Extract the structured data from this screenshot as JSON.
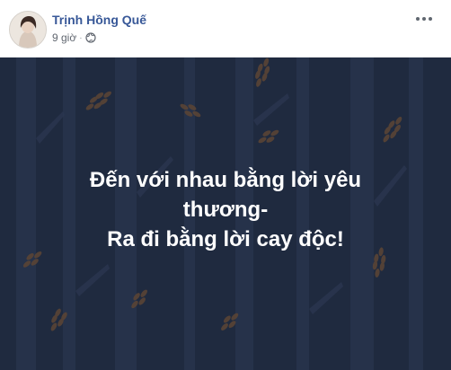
{
  "post": {
    "author_name": "Trịnh Hồng Quế",
    "timestamp": "9 giờ",
    "separator": "·",
    "privacy_icon": "globe-icon",
    "more_icon": "more-options-icon",
    "background_color": "#1f2a3f",
    "text_lines": [
      "Đến với nhau bằng lời yêu",
      "thương-",
      "Ra đi bằng lời cay độc!"
    ],
    "link_color": "#385898"
  }
}
